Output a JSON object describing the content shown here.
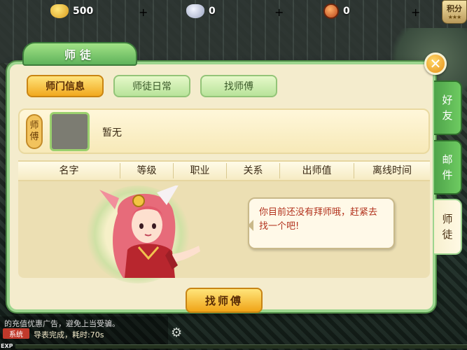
{
  "resources": [
    {
      "name": "gold-ingot",
      "value": "500"
    },
    {
      "name": "silver-ingot",
      "value": "0"
    },
    {
      "name": "copper-coin",
      "value": "0"
    }
  ],
  "jifen_label": "积分",
  "jifen_stars": "★★★",
  "panel_title": "师徒",
  "tabs": [
    {
      "label": "师门信息",
      "active": true
    },
    {
      "label": "师徒日常",
      "active": false
    },
    {
      "label": "找师傅",
      "active": false
    }
  ],
  "master": {
    "role_top": "师",
    "role_bottom": "傅",
    "name": "暂无"
  },
  "table_headers": [
    "名字",
    "等级",
    "职业",
    "关系",
    "出师值",
    "离线时间"
  ],
  "bubble_text": "你目前还没有拜师哦，赶紧去找一个吧!",
  "find_button": "找师傅",
  "side_tabs": [
    {
      "top": "好",
      "bottom": "友",
      "active": false
    },
    {
      "top": "邮",
      "bottom": "件",
      "active": false
    },
    {
      "top": "师",
      "bottom": "徒",
      "active": true
    }
  ],
  "chat": {
    "line1": "的充值优惠广告，避免上当受骗。",
    "system_tag": "系统",
    "line2": "导表完成，耗时:70s"
  },
  "exp_label": "EXP",
  "colors": {
    "panel_border": "#9cd58e",
    "active_tab": "#f1a91e",
    "bubble_text": "#b2321d"
  }
}
